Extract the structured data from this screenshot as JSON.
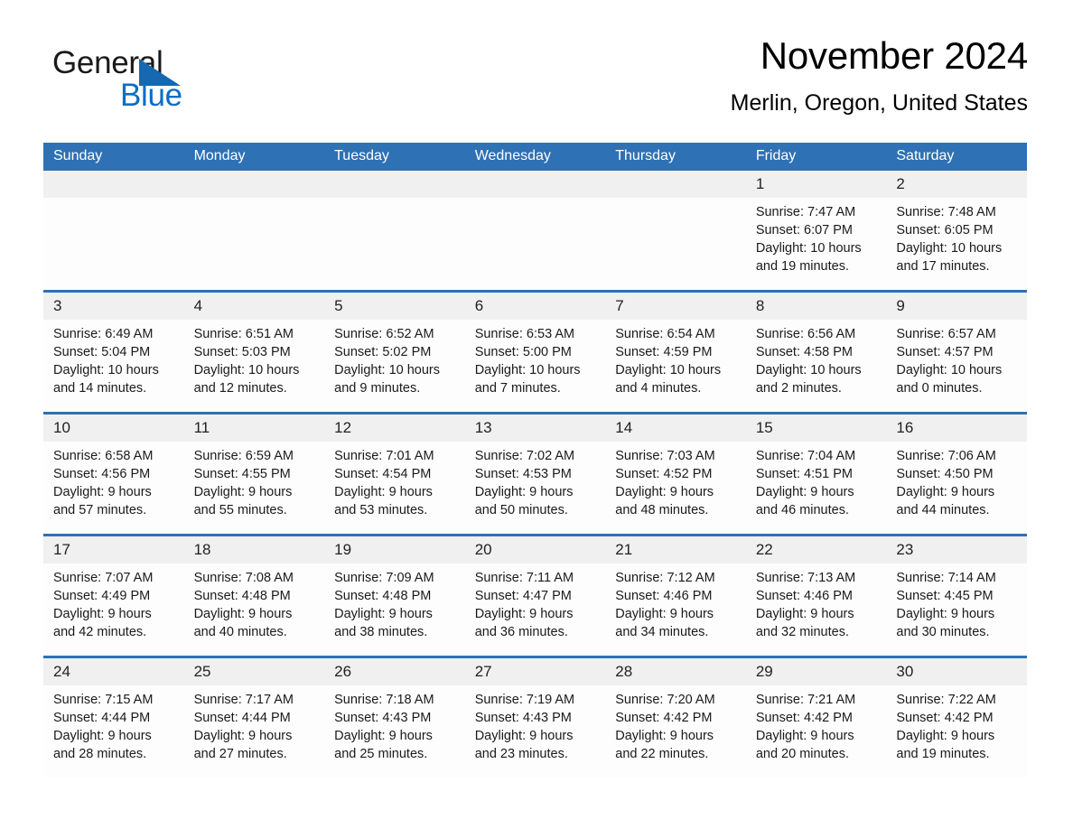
{
  "brand": {
    "name_part1": "General",
    "name_part2": "Blue"
  },
  "header": {
    "month_title": "November 2024",
    "location": "Merlin, Oregon, United States"
  },
  "colors": {
    "header_blue": "#2e71b4",
    "logo_blue": "#0a6ec4",
    "daynum_band": "#f0f0f0",
    "cell_background": "#fdfdfd"
  },
  "weekday_headers": [
    "Sunday",
    "Monday",
    "Tuesday",
    "Wednesday",
    "Thursday",
    "Friday",
    "Saturday"
  ],
  "weeks": [
    [
      {
        "day": "",
        "empty": true
      },
      {
        "day": "",
        "empty": true
      },
      {
        "day": "",
        "empty": true
      },
      {
        "day": "",
        "empty": true
      },
      {
        "day": "",
        "empty": true
      },
      {
        "day": "1",
        "sunrise": "Sunrise: 7:47 AM",
        "sunset": "Sunset: 6:07 PM",
        "daylight": "Daylight: 10 hours and 19 minutes."
      },
      {
        "day": "2",
        "sunrise": "Sunrise: 7:48 AM",
        "sunset": "Sunset: 6:05 PM",
        "daylight": "Daylight: 10 hours and 17 minutes."
      }
    ],
    [
      {
        "day": "3",
        "sunrise": "Sunrise: 6:49 AM",
        "sunset": "Sunset: 5:04 PM",
        "daylight": "Daylight: 10 hours and 14 minutes."
      },
      {
        "day": "4",
        "sunrise": "Sunrise: 6:51 AM",
        "sunset": "Sunset: 5:03 PM",
        "daylight": "Daylight: 10 hours and 12 minutes."
      },
      {
        "day": "5",
        "sunrise": "Sunrise: 6:52 AM",
        "sunset": "Sunset: 5:02 PM",
        "daylight": "Daylight: 10 hours and 9 minutes."
      },
      {
        "day": "6",
        "sunrise": "Sunrise: 6:53 AM",
        "sunset": "Sunset: 5:00 PM",
        "daylight": "Daylight: 10 hours and 7 minutes."
      },
      {
        "day": "7",
        "sunrise": "Sunrise: 6:54 AM",
        "sunset": "Sunset: 4:59 PM",
        "daylight": "Daylight: 10 hours and 4 minutes."
      },
      {
        "day": "8",
        "sunrise": "Sunrise: 6:56 AM",
        "sunset": "Sunset: 4:58 PM",
        "daylight": "Daylight: 10 hours and 2 minutes."
      },
      {
        "day": "9",
        "sunrise": "Sunrise: 6:57 AM",
        "sunset": "Sunset: 4:57 PM",
        "daylight": "Daylight: 10 hours and 0 minutes."
      }
    ],
    [
      {
        "day": "10",
        "sunrise": "Sunrise: 6:58 AM",
        "sunset": "Sunset: 4:56 PM",
        "daylight": "Daylight: 9 hours and 57 minutes."
      },
      {
        "day": "11",
        "sunrise": "Sunrise: 6:59 AM",
        "sunset": "Sunset: 4:55 PM",
        "daylight": "Daylight: 9 hours and 55 minutes."
      },
      {
        "day": "12",
        "sunrise": "Sunrise: 7:01 AM",
        "sunset": "Sunset: 4:54 PM",
        "daylight": "Daylight: 9 hours and 53 minutes."
      },
      {
        "day": "13",
        "sunrise": "Sunrise: 7:02 AM",
        "sunset": "Sunset: 4:53 PM",
        "daylight": "Daylight: 9 hours and 50 minutes."
      },
      {
        "day": "14",
        "sunrise": "Sunrise: 7:03 AM",
        "sunset": "Sunset: 4:52 PM",
        "daylight": "Daylight: 9 hours and 48 minutes."
      },
      {
        "day": "15",
        "sunrise": "Sunrise: 7:04 AM",
        "sunset": "Sunset: 4:51 PM",
        "daylight": "Daylight: 9 hours and 46 minutes."
      },
      {
        "day": "16",
        "sunrise": "Sunrise: 7:06 AM",
        "sunset": "Sunset: 4:50 PM",
        "daylight": "Daylight: 9 hours and 44 minutes."
      }
    ],
    [
      {
        "day": "17",
        "sunrise": "Sunrise: 7:07 AM",
        "sunset": "Sunset: 4:49 PM",
        "daylight": "Daylight: 9 hours and 42 minutes."
      },
      {
        "day": "18",
        "sunrise": "Sunrise: 7:08 AM",
        "sunset": "Sunset: 4:48 PM",
        "daylight": "Daylight: 9 hours and 40 minutes."
      },
      {
        "day": "19",
        "sunrise": "Sunrise: 7:09 AM",
        "sunset": "Sunset: 4:48 PM",
        "daylight": "Daylight: 9 hours and 38 minutes."
      },
      {
        "day": "20",
        "sunrise": "Sunrise: 7:11 AM",
        "sunset": "Sunset: 4:47 PM",
        "daylight": "Daylight: 9 hours and 36 minutes."
      },
      {
        "day": "21",
        "sunrise": "Sunrise: 7:12 AM",
        "sunset": "Sunset: 4:46 PM",
        "daylight": "Daylight: 9 hours and 34 minutes."
      },
      {
        "day": "22",
        "sunrise": "Sunrise: 7:13 AM",
        "sunset": "Sunset: 4:46 PM",
        "daylight": "Daylight: 9 hours and 32 minutes."
      },
      {
        "day": "23",
        "sunrise": "Sunrise: 7:14 AM",
        "sunset": "Sunset: 4:45 PM",
        "daylight": "Daylight: 9 hours and 30 minutes."
      }
    ],
    [
      {
        "day": "24",
        "sunrise": "Sunrise: 7:15 AM",
        "sunset": "Sunset: 4:44 PM",
        "daylight": "Daylight: 9 hours and 28 minutes."
      },
      {
        "day": "25",
        "sunrise": "Sunrise: 7:17 AM",
        "sunset": "Sunset: 4:44 PM",
        "daylight": "Daylight: 9 hours and 27 minutes."
      },
      {
        "day": "26",
        "sunrise": "Sunrise: 7:18 AM",
        "sunset": "Sunset: 4:43 PM",
        "daylight": "Daylight: 9 hours and 25 minutes."
      },
      {
        "day": "27",
        "sunrise": "Sunrise: 7:19 AM",
        "sunset": "Sunset: 4:43 PM",
        "daylight": "Daylight: 9 hours and 23 minutes."
      },
      {
        "day": "28",
        "sunrise": "Sunrise: 7:20 AM",
        "sunset": "Sunset: 4:42 PM",
        "daylight": "Daylight: 9 hours and 22 minutes."
      },
      {
        "day": "29",
        "sunrise": "Sunrise: 7:21 AM",
        "sunset": "Sunset: 4:42 PM",
        "daylight": "Daylight: 9 hours and 20 minutes."
      },
      {
        "day": "30",
        "sunrise": "Sunrise: 7:22 AM",
        "sunset": "Sunset: 4:42 PM",
        "daylight": "Daylight: 9 hours and 19 minutes."
      }
    ]
  ]
}
